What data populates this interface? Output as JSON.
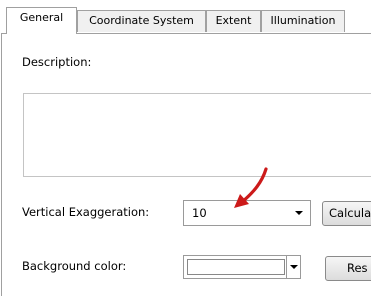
{
  "tabs": [
    {
      "label": "General",
      "active": true
    },
    {
      "label": "Coordinate System"
    },
    {
      "label": "Extent"
    },
    {
      "label": "Illumination"
    }
  ],
  "general": {
    "description_label": "Description:",
    "description_value": "",
    "vertical_exaggeration_label": "Vertical Exaggeration:",
    "vertical_exaggeration_value": "10",
    "calculate_button_label": "Calcula",
    "background_color_label": "Background color:",
    "background_color": "#ffffff",
    "restore_button_label": "Res"
  },
  "annotation": {
    "arrow_color": "#cc1a1a"
  }
}
